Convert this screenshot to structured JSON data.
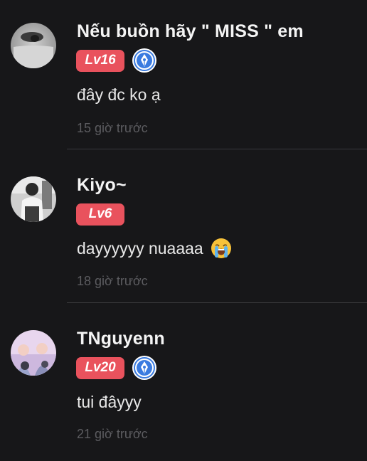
{
  "comments": [
    {
      "username": "Nếu buồn hãy \" MISS \" em",
      "level": "Lv16",
      "has_pen_badge": true,
      "text": "đây đc ko ạ",
      "time": "15 giờ trước",
      "avatar_icon": "avatar-photo-eye"
    },
    {
      "username": "Kiyo~",
      "level": "Lv6",
      "has_pen_badge": false,
      "text": "dayyyyyy nuaaaa",
      "emoji": "loudly-crying-face-icon",
      "time": "18 giờ trước",
      "avatar_icon": "avatar-photo-person"
    },
    {
      "username": "TNguyenn",
      "level": "Lv20",
      "has_pen_badge": true,
      "text": "tui đâyyy",
      "time": "21 giờ trước",
      "avatar_icon": "avatar-photo-group"
    }
  ],
  "colors": {
    "background": "#171719",
    "level_badge": "#e9525d",
    "pen_badge": "#3a7be0",
    "timestamp": "#5c5c60",
    "divider": "#3a3a3d"
  }
}
